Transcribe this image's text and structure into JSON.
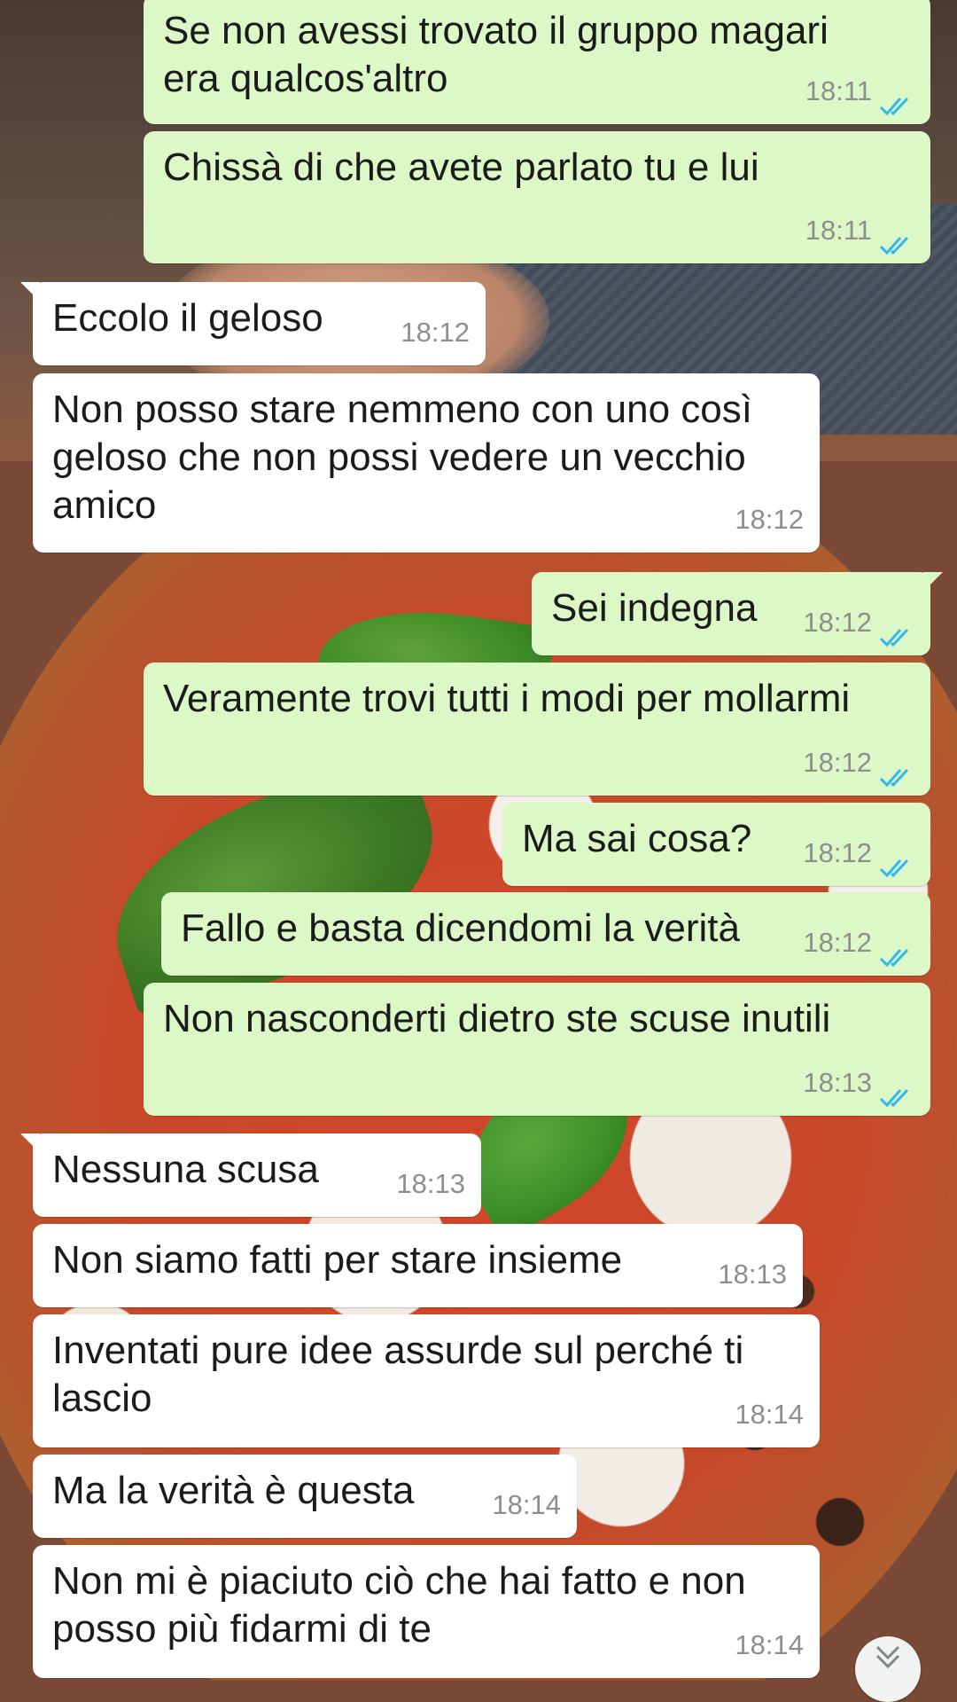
{
  "colors": {
    "outgoing_bubble": "#dcf8c6",
    "incoming_bubble": "#ffffff",
    "read_tick": "#34b7f1",
    "timestamp": "#8e8e8e"
  },
  "messages": [
    {
      "direction": "out",
      "text": "Se non avessi trovato il gruppo magari\nera qualcos'altro",
      "time": "18:11",
      "status": "read"
    },
    {
      "direction": "out",
      "text": "Chissà di che avete parlato tu e lui",
      "time": "18:11",
      "status": "read"
    },
    {
      "direction": "in",
      "text": "Eccolo il geloso",
      "time": "18:12"
    },
    {
      "direction": "in",
      "text": "Non posso stare nemmeno con uno così\ngeloso che non possi vedere un vecchio\namico",
      "time": "18:12"
    },
    {
      "direction": "out",
      "text": "Sei indegna",
      "time": "18:12",
      "status": "read"
    },
    {
      "direction": "out",
      "text": "Veramente trovi tutti i modi per mollarmi",
      "time": "18:12",
      "status": "read"
    },
    {
      "direction": "out",
      "text": "Ma sai cosa?",
      "time": "18:12",
      "status": "read"
    },
    {
      "direction": "out",
      "text": "Fallo e basta dicendomi la verità",
      "time": "18:12",
      "status": "read"
    },
    {
      "direction": "out",
      "text": "Non nasconderti dietro ste scuse inutili",
      "time": "18:13",
      "status": "read"
    },
    {
      "direction": "in",
      "text": "Nessuna scusa",
      "time": "18:13"
    },
    {
      "direction": "in",
      "text": "Non siamo fatti per stare insieme",
      "time": "18:13"
    },
    {
      "direction": "in",
      "text": "Inventati pure idee assurde sul perché ti\nlascio",
      "time": "18:14"
    },
    {
      "direction": "in",
      "text": "Ma la verità è questa",
      "time": "18:14"
    },
    {
      "direction": "in",
      "text": "Non mi è piaciuto ciò che hai fatto e non\nposso più fidarmi di te",
      "time": "18:14"
    }
  ],
  "scroll_button": {
    "icon": "chevron-down-icon"
  }
}
